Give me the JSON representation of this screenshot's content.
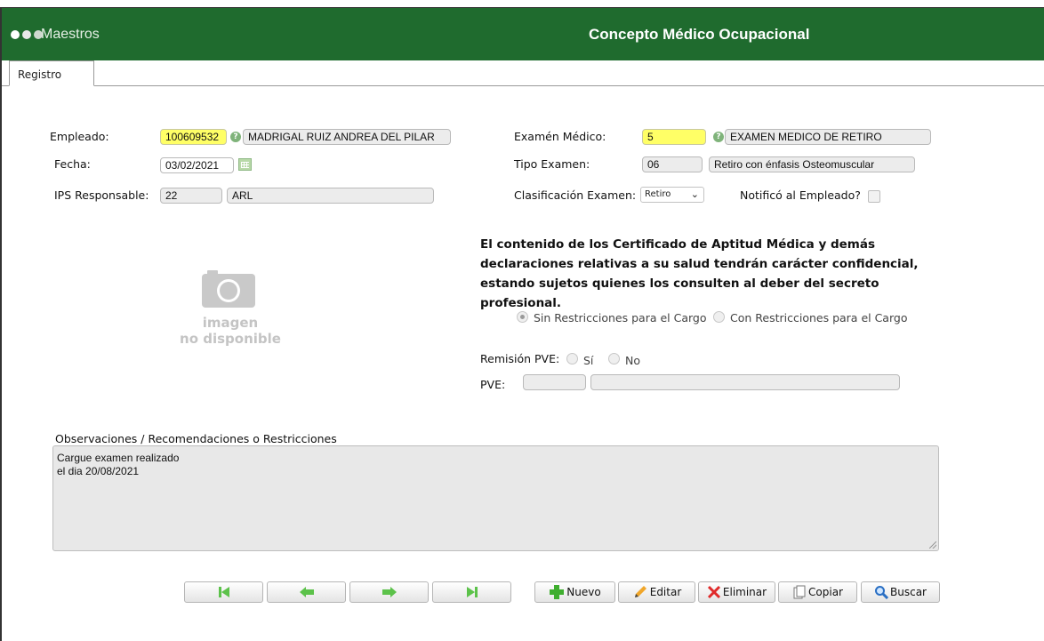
{
  "header": {
    "module": "Maestros",
    "title": "Concepto Médico Ocupacional"
  },
  "tabs": [
    {
      "label": "Registro"
    }
  ],
  "form": {
    "empleado": {
      "label": "Empleado:",
      "code": "100609532",
      "name": "MADRIGAL RUIZ ANDREA DEL PILAR"
    },
    "fecha": {
      "label": "Fecha:",
      "value": "03/02/2021"
    },
    "ips": {
      "label": "IPS Responsable:",
      "code": "22",
      "name": "ARL"
    },
    "examen": {
      "label": "Examén Médico:",
      "code": "5",
      "name": "EXAMEN MEDICO DE RETIRO"
    },
    "tipo": {
      "label": "Tipo Examen:",
      "code": "06",
      "name": "Retiro con énfasis Osteomuscular"
    },
    "clasificacion": {
      "label": "Clasificación Examen:",
      "selected": "Retiro"
    },
    "notifico": {
      "label": "Notificó al Empleado?",
      "checked": false
    }
  },
  "no_image": {
    "line1": "imagen",
    "line2": "no disponible"
  },
  "confidential_text": "El contenido de los Certificado de Aptitud Médica y demás declaraciones relativas a su salud tendrán carácter confidencial, estando sujetos quienes los consulten al deber del secreto profesional.",
  "restricciones": {
    "option1": "Sin Restricciones para el Cargo",
    "option2": "Con Restricciones para el Cargo",
    "selected": "option1"
  },
  "remision": {
    "label": "Remisión PVE:",
    "yes": "Sí",
    "no": "No"
  },
  "pve": {
    "label": "PVE:",
    "code": "",
    "name": ""
  },
  "observaciones": {
    "label": "Observaciones / Recomendaciones o Restricciones",
    "value": "Cargue examen realizado\nel dia 20/08/2021"
  },
  "toolbar": {
    "nuevo": "Nuevo",
    "editar": "Editar",
    "eliminar": "Eliminar",
    "copiar": "Copiar",
    "buscar": "Buscar"
  },
  "colors": {
    "header_green": "#1f6b2e",
    "nav_arrow_green": "#5cc24a",
    "highlight_yellow": "#ffff66"
  }
}
